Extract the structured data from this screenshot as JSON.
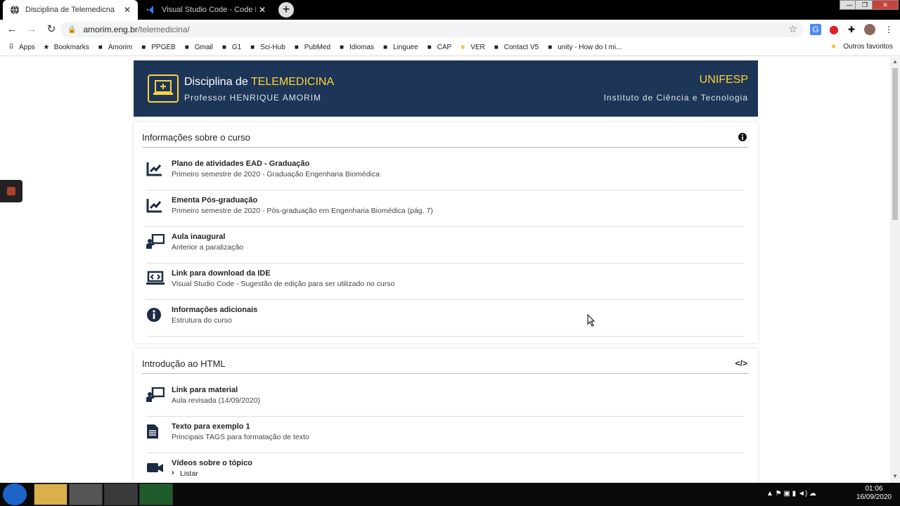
{
  "browser": {
    "tabs": [
      {
        "title": "Disciplina de Telemedicna",
        "active": true,
        "icon": "globe-icon"
      },
      {
        "title": "Visual Studio Code - Code Editin",
        "active": false,
        "icon": "vscode-icon"
      }
    ],
    "new_tab_symbol": "+",
    "url_host": "amorim.eng.br",
    "url_path": "/telemedicina/",
    "bookmarks": [
      {
        "label": "Apps",
        "icon": "apps-icon"
      },
      {
        "label": "Bookmarks",
        "icon": "star-icon"
      },
      {
        "label": "Amorim",
        "icon": "shield-icon"
      },
      {
        "label": "PPGEB",
        "icon": "pin-icon"
      },
      {
        "label": "Gmail",
        "icon": "gmail-icon"
      },
      {
        "label": "G1",
        "icon": "g1-icon"
      },
      {
        "label": "Sci-Hub",
        "icon": "scihub-icon"
      },
      {
        "label": "PubMed",
        "icon": "pubmed-icon"
      },
      {
        "label": "Idiomas",
        "icon": "translate-icon"
      },
      {
        "label": "Linguee",
        "icon": "linguee-icon"
      },
      {
        "label": "CAP",
        "icon": "cap-icon"
      },
      {
        "label": "VER",
        "icon": "folder-icon"
      },
      {
        "label": "Contact V5",
        "icon": "home-icon"
      },
      {
        "label": "unity - How do I mi...",
        "icon": "ask-icon"
      }
    ],
    "bookmarks_right": "Outros favoritos"
  },
  "header": {
    "title_prefix": "Disciplina de ",
    "title_accent": "TELEMEDICINA",
    "subtitle": "Professor HENRIQUE AMORIM",
    "institution": "UNIFESP",
    "institute": "Instituto de Ciência e Tecnologia",
    "accent_color": "#ffd43b",
    "bg_color": "#1d3557"
  },
  "course_info": {
    "heading": "Informações sobre o curso",
    "items": [
      {
        "title": "Plano de atividades EAD - Graduação",
        "sub": "Primeiro semestre de 2020 - Graduação Engenharia Biomédica",
        "icon": "chart-pen-icon"
      },
      {
        "title": "Ementa Pós-graduação",
        "sub": "Primeiro semestre de 2020 - Pós-graduação em Engenharia Biomédica (pág. 7)",
        "icon": "chart-pen-icon"
      },
      {
        "title": "Aula inaugural",
        "sub": "Anterior a paralização",
        "icon": "teacher-board-icon"
      },
      {
        "title": "Link para download da IDE",
        "sub": "Visual Studio Code - Sugestão de edição para ser utilizado no curso",
        "icon": "laptop-code-icon"
      },
      {
        "title": "Informações adicionais",
        "sub": "Estrutura do curso",
        "icon": "info-circle-icon"
      }
    ]
  },
  "html_intro": {
    "heading": "Introdução ao HTML",
    "items": [
      {
        "title": "Link para material",
        "sub": "Aula revisada (14/09/2020)",
        "icon": "teacher-board-icon"
      },
      {
        "title": "Texto para exemplo 1",
        "sub": "Principais TAGS para formatação de texto",
        "icon": "document-icon"
      },
      {
        "title": "Vídeos sobre o tópico",
        "sub": "Listar",
        "icon": "video-camera-icon"
      }
    ]
  },
  "taskbar": {
    "time": "01:06",
    "date": "16/09/2020"
  }
}
